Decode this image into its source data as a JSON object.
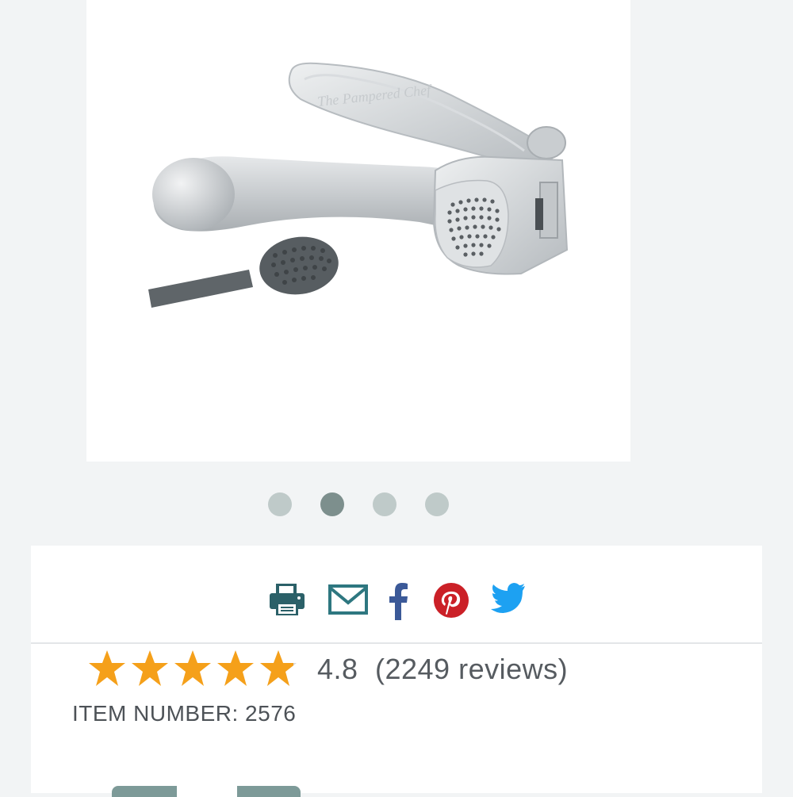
{
  "gallery": {
    "image_alt": "Garlic press with cleaning tool",
    "dot_count": 4,
    "active_dot": 2
  },
  "share": {
    "icons": [
      "print-icon",
      "email-icon",
      "facebook-icon",
      "pinterest-icon",
      "twitter-icon"
    ],
    "colors": {
      "print": "#2b6068",
      "email": "#2e7780",
      "facebook": "#3b5998",
      "pinterest": "#cb2027",
      "twitter": "#1da1f2"
    }
  },
  "product": {
    "rating": "4.8",
    "review_count_text": "(2249 reviews)",
    "stars": 5,
    "star_color": "#f5a01a",
    "item_number_text": "ITEM NUMBER: 2576"
  }
}
